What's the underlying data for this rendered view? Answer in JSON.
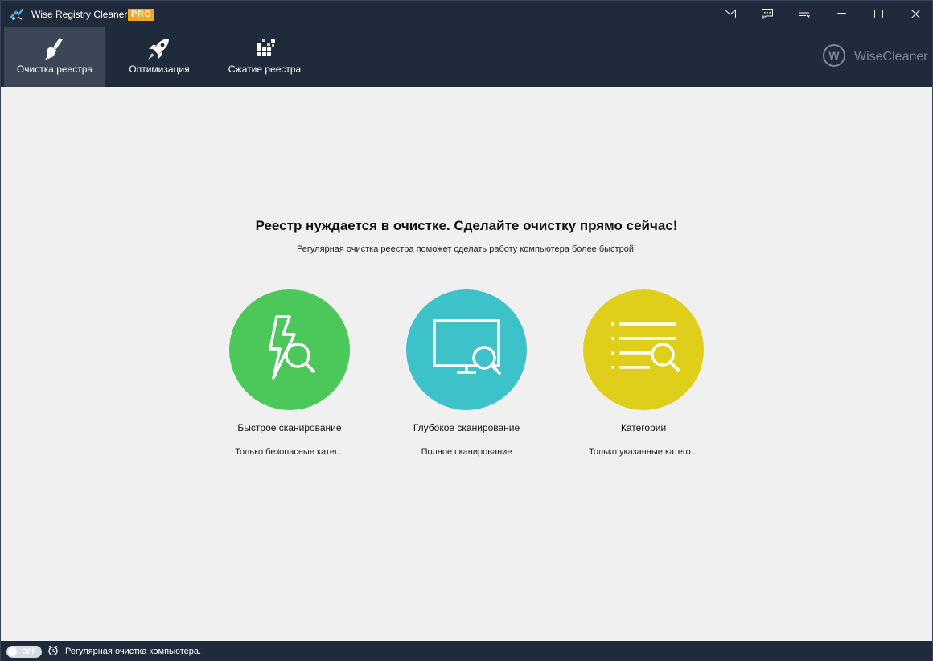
{
  "window": {
    "title": "Wise Registry Cleaner X",
    "badge": "PRO"
  },
  "titlebar_buttons": [
    {
      "icon": "mail-icon"
    },
    {
      "icon": "feedback-icon"
    },
    {
      "icon": "menu-icon"
    },
    {
      "icon": "minimize-icon"
    },
    {
      "icon": "maximize-icon"
    },
    {
      "icon": "close-icon"
    }
  ],
  "toolbar": {
    "tabs": [
      {
        "label": "Очистка реестра",
        "icon": "broom-icon",
        "active": true
      },
      {
        "label": "Оптимизация",
        "icon": "rocket-icon",
        "active": false
      },
      {
        "label": "Сжатие реестра",
        "icon": "blocks-icon",
        "active": false
      }
    ],
    "brand": "WiseCleaner"
  },
  "main": {
    "headline": "Реестр нуждается в очистке. Сделайте очистку прямо сейчас!",
    "subline": "Регулярная очистка реестра поможет сделать работу компьютера более быстрой.",
    "cards": [
      {
        "title": "Быстрое сканирование",
        "desc": "Только безопасные катег...",
        "color": "#4cc85a",
        "icon": "lightning-search-icon"
      },
      {
        "title": "Глубокое сканирование",
        "desc": "Полное сканирование",
        "color": "#3cc2c8",
        "icon": "monitor-search-icon"
      },
      {
        "title": "Категории",
        "desc": "Только указанные катего...",
        "color": "#e0cf1a",
        "icon": "list-search-icon"
      }
    ]
  },
  "statusbar": {
    "toggle_label": "OFF",
    "text": "Регулярная очистка компьютера."
  },
  "colors": {
    "dark": "#1f2a3a",
    "active_tab": "#3c4656",
    "background": "#f0f0f0",
    "badge": "#f5a623"
  }
}
